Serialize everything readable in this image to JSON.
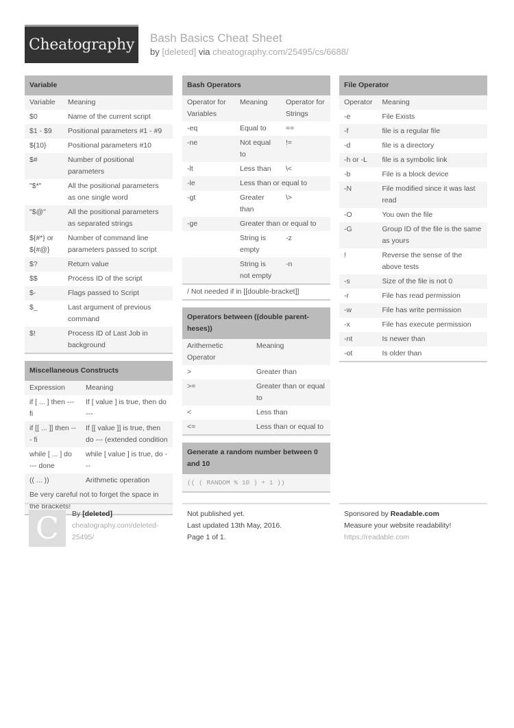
{
  "header": {
    "logo": "Cheatography",
    "title": "Bash Basics Cheat Sheet",
    "by_label": "by",
    "author": "[deleted]",
    "via_label": "via",
    "url": "cheatography.com/25495/cs/6688/"
  },
  "variable": {
    "title": "Variable",
    "columns": [
      "Variable",
      "Meaning"
    ],
    "rows": [
      [
        "$0",
        "Name of the current script"
      ],
      [
        "$1 - $9",
        "Positional parameters #1 - #9"
      ],
      [
        "${10}",
        "Positional parameters #10"
      ],
      [
        "$#",
        "Number of positional parameters"
      ],
      [
        "\"$*\"",
        "All the positional parameters as one single word"
      ],
      [
        "\"$@\"",
        "All the positional parameters as separated strings"
      ],
      [
        "${#*} or ${#@}",
        "Number of command line parameters passed to script"
      ],
      [
        "$?",
        "Return value"
      ],
      [
        "$$",
        "Process ID of the script"
      ],
      [
        "$-",
        "Flags passed to Script"
      ],
      [
        "$_",
        "Last argument of previous command"
      ],
      [
        "$!",
        "Process ID of Last Job in background"
      ]
    ]
  },
  "misc": {
    "title": "Miscellaneous Constructs",
    "columns": [
      "Expression",
      "Meaning"
    ],
    "rows": [
      [
        "if [ ... ] then --- fi",
        "If [ value ] is true, then do ---"
      ],
      [
        "if [[ ... ]] then --- fi",
        "If [[ value ]] is true, then do --- (extended condition"
      ],
      [
        "while [ ... ] do --- done",
        "while [ value ] is true, do ---"
      ],
      [
        "(( ... ))",
        "Arithmetic operation"
      ]
    ],
    "note": "Be very careful not to forget the space in the brackets!"
  },
  "bash_ops": {
    "title": "Bash Operators",
    "columns": [
      "Operator for Variables",
      "Meaning",
      "Operator for Strings"
    ],
    "rows": [
      [
        "-eq",
        "Equal to",
        "=="
      ],
      [
        "-ne",
        "Not equal to",
        "!="
      ],
      [
        "-lt",
        "Less than",
        "\\<"
      ],
      [
        "-le",
        "Less than or equal to",
        ""
      ],
      [
        "-gt",
        "Greater than",
        "\\>"
      ],
      [
        "-ge",
        "Greater than or equal to",
        ""
      ],
      [
        "",
        "String is empty",
        "-z"
      ],
      [
        "",
        "String is not empty",
        "-n"
      ]
    ],
    "note": "/ Not needed if in [[double-bracket]]"
  },
  "arith_ops": {
    "title": "Operators between ((double parent-heses))",
    "columns": [
      "Arithemetic Operator",
      "Meaning"
    ],
    "rows": [
      [
        ">",
        "Greater than"
      ],
      [
        ">=",
        "Greater than or equal to"
      ],
      [
        "<",
        "Less than"
      ],
      [
        "<=",
        "Less than or equal to"
      ]
    ]
  },
  "random": {
    "title": "Generate a random number between 0 and 10",
    "code": "(( ( RANDOM % 10 ) + 1 ))"
  },
  "file_ops": {
    "title": "File Operator",
    "columns": [
      "Operator",
      "Meaning"
    ],
    "rows": [
      [
        "-e",
        "File Exists"
      ],
      [
        "-f",
        "file is a regular file"
      ],
      [
        "-d",
        "file is a directory"
      ],
      [
        "-h or -L",
        "file is a symbolic link"
      ],
      [
        "-b",
        "File is a block device"
      ],
      [
        "-N",
        "File modified since it was last read"
      ],
      [
        "-O",
        "You own the file"
      ],
      [
        "-G",
        "Group ID of the file is the same as yours"
      ],
      [
        "!",
        "Reverse the sense of the above tests"
      ],
      [
        "-s",
        "Size of the file is not 0"
      ],
      [
        "-r",
        "File has read permission"
      ],
      [
        "-w",
        "File has write permission"
      ],
      [
        "-x",
        "File has execute permission"
      ],
      [
        "-nt",
        "Is newer than"
      ],
      [
        "-ot",
        "Is older than"
      ]
    ]
  },
  "footer": {
    "avatar_letter": "C",
    "by_label": "By",
    "author": "[deleted]",
    "author_url": "cheatography.com/deleted-25495/",
    "published": "Not published yet.",
    "updated": "Last updated 13th May, 2016.",
    "page": "Page 1 of 1.",
    "sponsored_label": "Sponsored by",
    "sponsor": "Readable.com",
    "sponsor_tagline": "Measure your website readability!",
    "sponsor_url": "https://readable.com"
  }
}
